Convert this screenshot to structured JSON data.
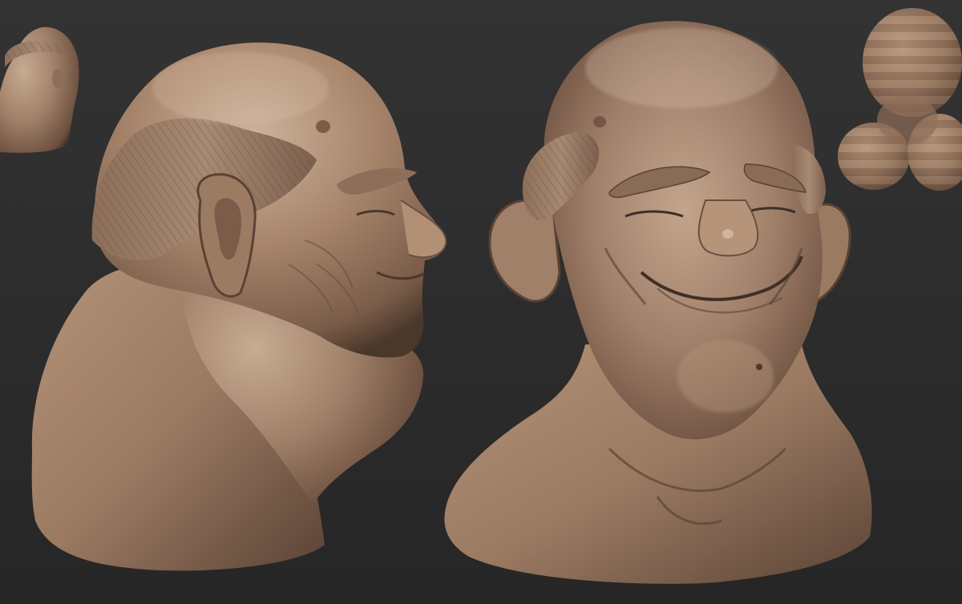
{
  "viewport": {
    "background_top": "#323232",
    "background_bottom": "#272727"
  },
  "material": {
    "base_color": "#9e7d63",
    "light_color": "#cdb29a",
    "shadow_color": "#4a382b",
    "rim_color": "#7d6150"
  },
  "objects": [
    {
      "name": "thumbnail-bust"
    },
    {
      "name": "side-view-bust"
    },
    {
      "name": "front-view-bust"
    },
    {
      "name": "navigation-gizmo"
    }
  ]
}
